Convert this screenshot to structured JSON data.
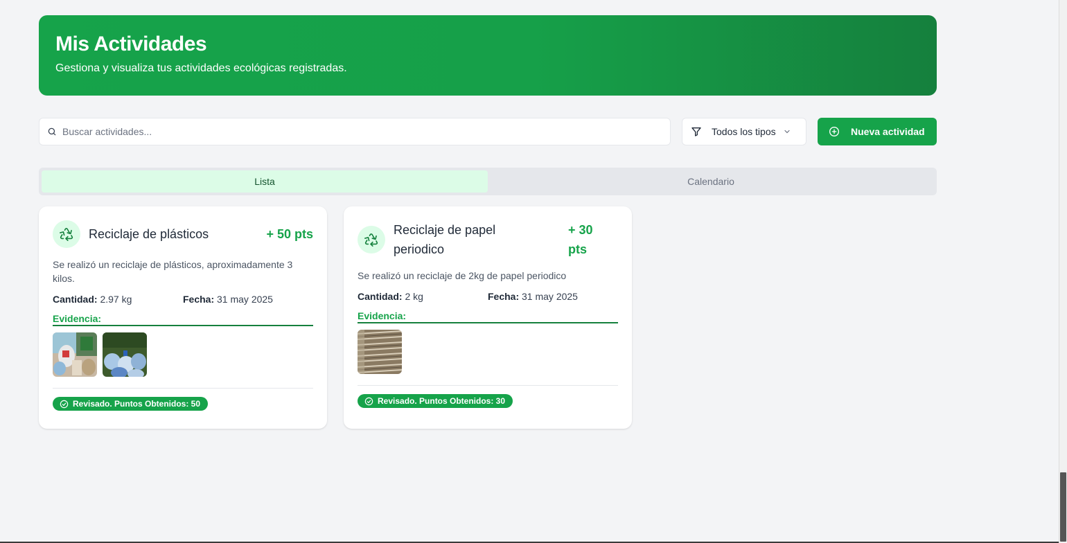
{
  "header": {
    "title": "Mis Actividades",
    "subtitle": "Gestiona y visualiza tus actividades ecológicas registradas."
  },
  "toolbar": {
    "search_placeholder": "Buscar actividades...",
    "search_value": "",
    "filter_label": "Todos los tipos",
    "new_button_label": "Nueva actividad"
  },
  "tabs": [
    {
      "label": "Lista",
      "active": true
    },
    {
      "label": "Calendario",
      "active": false
    }
  ],
  "activities": [
    {
      "title": "Reciclaje de plásticos",
      "points": "+ 50 pts",
      "description": "Se realizó un reciclaje de plásticos, aproximadamente 3 kilos.",
      "quantity_label": "Cantidad:",
      "quantity": "2.97 kg",
      "date_label": "Fecha:",
      "date": "31 may 2025",
      "evidence_label": "Evidencia:",
      "evidence_count": 2,
      "status": "Revisado. Puntos Obtenidos: 50"
    },
    {
      "title": "Reciclaje de papel periodico",
      "points": "+ 30 pts",
      "description": "Se realizó un reciclaje de 2kg de papel periodico",
      "quantity_label": "Cantidad:",
      "quantity": "2 kg",
      "date_label": "Fecha:",
      "date": "31 may 2025",
      "evidence_label": "Evidencia:",
      "evidence_count": 1,
      "status": "Revisado. Puntos Obtenidos: 30"
    }
  ],
  "colors": {
    "brand": "#16a34a",
    "brand_dark": "#15803d",
    "icon_bg": "#dcfce7",
    "page_bg": "#f3f4f6"
  },
  "icons": {
    "search": "search-icon",
    "filter": "filter-icon",
    "chevron": "chevron-down-icon",
    "new": "plus-circle-icon",
    "activity": "recycle-icon",
    "status": "check-circle-icon"
  }
}
